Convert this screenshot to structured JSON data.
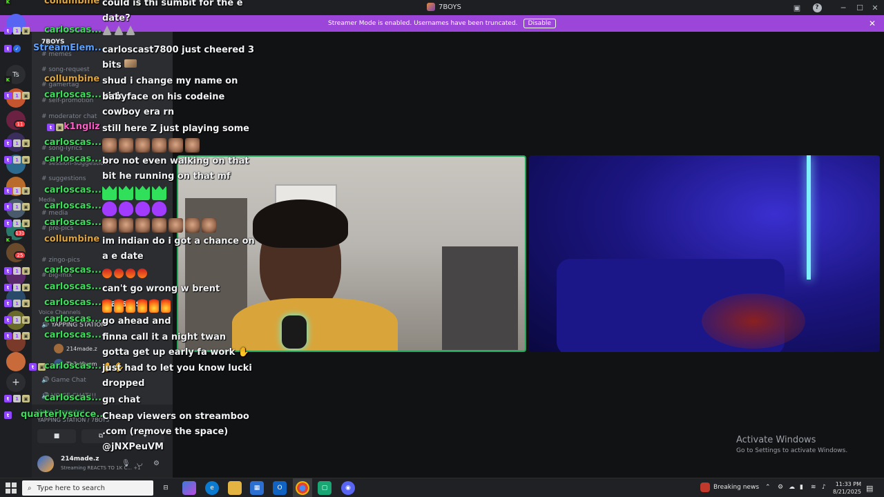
{
  "window": {
    "title": "7BOYS"
  },
  "banner": {
    "text": "Streamer Mode is enabled. Usernames have been truncated.",
    "button": "Disable",
    "color": "#9b45d9"
  },
  "rail": {
    "label_ts": "Ts",
    "badges": [
      "11",
      "131",
      "25"
    ]
  },
  "channels": {
    "server_name": "7BOYS",
    "items": [
      "memes",
      "song-request",
      "gamertag",
      "self-promotion",
      "moderator chat",
      "song-lyrics",
      "session-suggestion",
      "suggestions",
      "media",
      "pre-pics",
      "zingo-pics",
      "big-mix"
    ],
    "category_media": "Media",
    "category_voice": "Voice Channels",
    "voice_channel": "YAPPING STATION",
    "voice_users": [
      "214made.z",
      "Th3vl0vem"
    ],
    "game_chat": "Game Chat",
    "voice_chat": "VOICE CHAT!!!"
  },
  "voice_panel": {
    "status": "Video Connected",
    "location": "YAPPING STATION / 7BOYS"
  },
  "user": {
    "name": "214made.z",
    "sub": "Streaming REACTS TO 1K C...",
    "extra": "+1"
  },
  "activate": {
    "title": "Activate Windows",
    "sub": "Go to Settings to activate Windows."
  },
  "chat": [
    {
      "user": "collumbine",
      "color": "#e0a53a",
      "platform": "kick",
      "text": "could is thi sumbit for the e date?"
    },
    {
      "user": "carloscas...",
      "color": "#3ddc5a",
      "platform": "twitch",
      "text": ""
    },
    {
      "user": "StreamElem...",
      "color": "#5aa0ff",
      "platform": "twitch",
      "text": "carloscast7800 just cheered 3 bits"
    },
    {
      "user": "collumbine",
      "color": "#e0a53a",
      "platform": "kick",
      "text": "shud i change my name on kick"
    },
    {
      "user": "carloscas...",
      "color": "#3ddc5a",
      "platform": "twitch",
      "text": "babyface on his codeine cowboy era rn"
    },
    {
      "user": "k1ngliz",
      "color": "#ff5cc8",
      "platform": "twitch",
      "text": "still here Z just playing some RP"
    },
    {
      "user": "carloscas...",
      "color": "#3ddc5a",
      "platform": "twitch",
      "text": ""
    },
    {
      "user": "carloscas...",
      "color": "#3ddc5a",
      "platform": "twitch",
      "text": "bro not even walking on that bit he running on that mf"
    },
    {
      "user": "carloscas...",
      "color": "#3ddc5a",
      "platform": "twitch",
      "text": ""
    },
    {
      "user": "carloscas...",
      "color": "#3ddc5a",
      "platform": "twitch",
      "text": ""
    },
    {
      "user": "carloscas...",
      "color": "#3ddc5a",
      "platform": "twitch",
      "text": ""
    },
    {
      "user": "collumbine",
      "color": "#e0a53a",
      "platform": "kick",
      "text": "im indian do i got a chance on a e date"
    },
    {
      "user": "carloscas...",
      "color": "#3ddc5a",
      "platform": "twitch",
      "text": ""
    },
    {
      "user": "carloscas...",
      "color": "#3ddc5a",
      "platform": "twitch",
      "text": "can't go wrong w brent classics"
    },
    {
      "user": "carloscas...",
      "color": "#3ddc5a",
      "platform": "twitch",
      "text": ""
    },
    {
      "user": "carloscas...",
      "color": "#3ddc5a",
      "platform": "twitch",
      "text": "go ahead and"
    },
    {
      "user": "carloscas...",
      "color": "#3ddc5a",
      "platform": "twitch",
      "text": "finna call it a night twan gotta get up early fa work"
    },
    {
      "user": "carloscas...",
      "color": "#3ddc5a",
      "platform": "twitch",
      "text": "just had to let you know lucki dropped"
    },
    {
      "user": "carloscas...",
      "color": "#3ddc5a",
      "platform": "twitch",
      "text": "gn chat"
    },
    {
      "user": "quarterlysucce...",
      "color": "#3ddc5a",
      "platform": "twitch",
      "text": "Cheap viewers on streamboo .com (remove the space) @jNXPeuVM"
    }
  ],
  "taskbar": {
    "search_placeholder": "Type here to search",
    "news": "Breaking news",
    "time": "11:33 PM",
    "date": "8/21/2025"
  }
}
